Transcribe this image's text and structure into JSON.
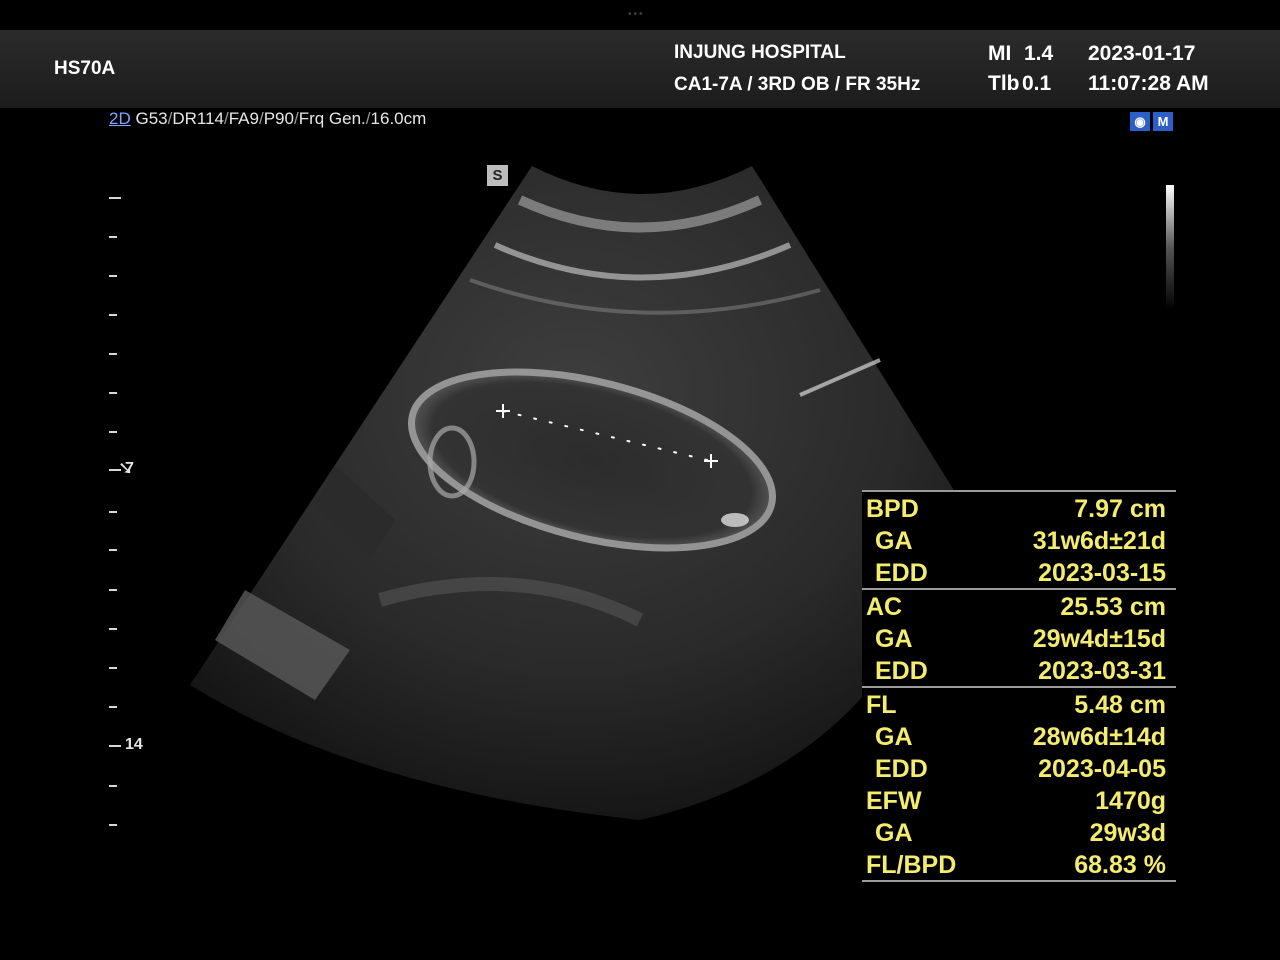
{
  "header": {
    "model": "HS70A",
    "hospital": "INJUNG HOSPITAL",
    "probe_info": "CA1-7A / 3RD OB / FR 35Hz",
    "mi_label": "MI",
    "mi_value": "1.4",
    "tib_label": "Tlb",
    "tib_value": "0.1",
    "date": "2023-01-17",
    "time": "11:07:28 AM"
  },
  "imaging_params": {
    "mode": "2D",
    "gain": "G53",
    "dynamic_range": "DR114",
    "frame_avg": "FA9",
    "power": "P90",
    "frequency": "Frq Gen.",
    "depth": "16.0cm"
  },
  "orientation_marker": "S",
  "toolbar_icons": [
    "camera-icon",
    "map-icon"
  ],
  "depth_scale": {
    "labels": [
      {
        "text": "7"
      },
      {
        "text": "14"
      }
    ]
  },
  "measurements": [
    {
      "rows": [
        {
          "label": "BPD",
          "value": "7.97 cm"
        },
        {
          "label": "GA",
          "value": "31w6d±21d"
        },
        {
          "label": "EDD",
          "value": "2023-03-15"
        }
      ]
    },
    {
      "rows": [
        {
          "label": "AC",
          "value": "25.53 cm"
        },
        {
          "label": "GA",
          "value": "29w4d±15d"
        },
        {
          "label": "EDD",
          "value": "2023-03-31"
        }
      ]
    },
    {
      "rows": [
        {
          "label": "FL",
          "value": "5.48 cm"
        },
        {
          "label": "GA",
          "value": "28w6d±14d"
        },
        {
          "label": "EDD",
          "value": "2023-04-05"
        },
        {
          "label": "EFW",
          "value": "1470g"
        },
        {
          "label": "GA",
          "value": "29w3d"
        },
        {
          "label": "FL/BPD",
          "value": "68.83 %"
        }
      ]
    }
  ],
  "colors": {
    "measurement_text": "#f4ec6e",
    "mode_accent": "#7fa6ff"
  }
}
